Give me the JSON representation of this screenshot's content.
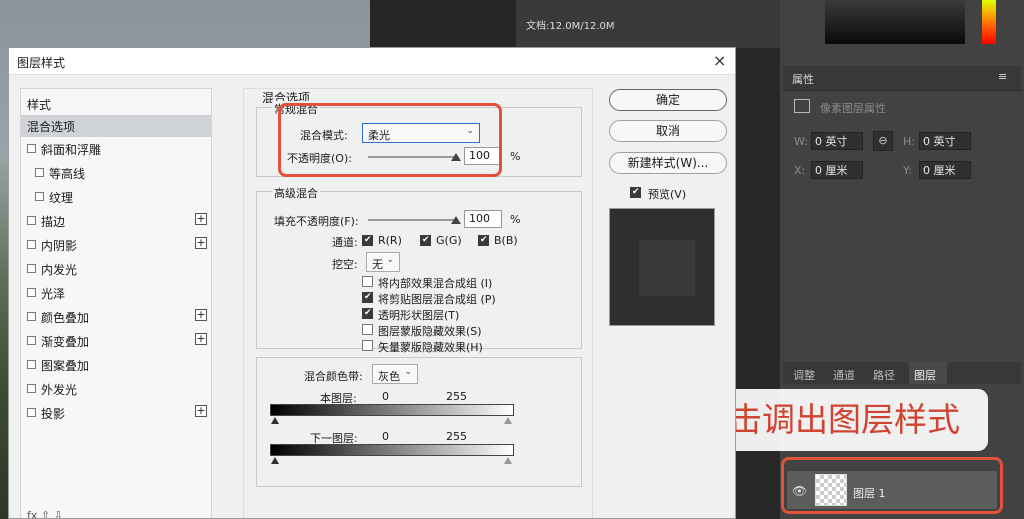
{
  "background": {
    "doc_info": "文档:12.0M/12.0M",
    "properties_panel": {
      "title": "属性",
      "sub_title": "像素图层属性",
      "w_label": "W:",
      "w_value": "0 英寸",
      "h_label": "H:",
      "h_value": "0 英寸",
      "x_label": "X:",
      "x_value": "0 厘米",
      "y_label": "Y:",
      "y_value": "0 厘米"
    },
    "layers_panel": {
      "tabs": [
        "调整",
        "通道",
        "路径",
        "图层"
      ],
      "layer_name": "图层 1"
    },
    "annotation": "双击调出图层样式"
  },
  "dialog": {
    "title": "图层样式",
    "close": "×",
    "sidebar": {
      "header": "样式",
      "items": [
        {
          "label": "混合选项",
          "checkbox": false,
          "plus": false,
          "active": true
        },
        {
          "label": "斜面和浮雕",
          "checkbox": true,
          "plus": false
        },
        {
          "label": "等高线",
          "checkbox": true,
          "plus": false,
          "indent": true
        },
        {
          "label": "纹理",
          "checkbox": true,
          "plus": false,
          "indent": true
        },
        {
          "label": "描边",
          "checkbox": true,
          "plus": true
        },
        {
          "label": "内阴影",
          "checkbox": true,
          "plus": true
        },
        {
          "label": "内发光",
          "checkbox": true,
          "plus": false
        },
        {
          "label": "光泽",
          "checkbox": true,
          "plus": false
        },
        {
          "label": "颜色叠加",
          "checkbox": true,
          "plus": true
        },
        {
          "label": "渐变叠加",
          "checkbox": true,
          "plus": true
        },
        {
          "label": "图案叠加",
          "checkbox": true,
          "plus": false
        },
        {
          "label": "外发光",
          "checkbox": true,
          "plus": false
        },
        {
          "label": "投影",
          "checkbox": true,
          "plus": true
        }
      ],
      "footer": "fx  ⇧  ⇩"
    },
    "blend_options": {
      "title": "混合选项",
      "general": {
        "title": "常规混合",
        "mode_label": "混合模式:",
        "mode_value": "柔光",
        "opacity_label": "不透明度(O):",
        "opacity_value": "100",
        "percent": "%"
      },
      "advanced": {
        "title": "高级混合",
        "fill_label": "填充不透明度(F):",
        "fill_value": "100",
        "percent": "%",
        "channels_label": "通道:",
        "channels": [
          "R(R)",
          "G(G)",
          "B(B)"
        ],
        "knockout_label": "挖空:",
        "knockout_value": "无",
        "options": [
          {
            "label": "将内部效果混合成组 (I)",
            "checked": false
          },
          {
            "label": "将剪贴图层混合成组 (P)",
            "checked": true
          },
          {
            "label": "透明形状图层(T)",
            "checked": true
          },
          {
            "label": "图层蒙版隐藏效果(S)",
            "checked": false
          },
          {
            "label": "矢量蒙版隐藏效果(H)",
            "checked": false
          }
        ]
      },
      "blend_if": {
        "label": "混合颜色带:",
        "value": "灰色",
        "this_layer": "本图层:",
        "underlying": "下一图层:",
        "min": "0",
        "max": "255"
      }
    },
    "buttons": {
      "ok": "确定",
      "cancel": "取消",
      "new_style": "新建样式(W)...",
      "preview_label": "预览(V)"
    }
  }
}
